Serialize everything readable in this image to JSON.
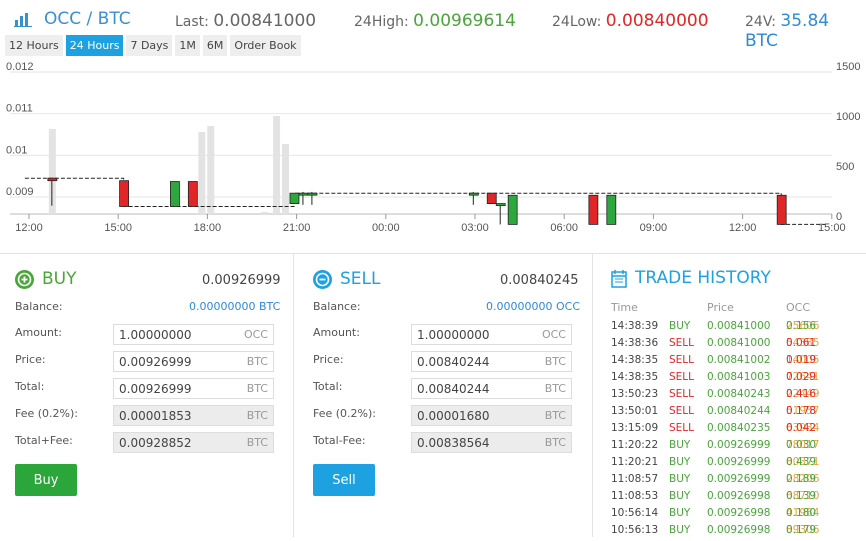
{
  "header": {
    "pair_base": "OCC",
    "pair_sep": " / ",
    "pair_quote": "BTC",
    "last_label": "Last:",
    "last_value": "0.00841000",
    "high_label": "24High:",
    "high_value": "0.00969614",
    "low_label": "24Low:",
    "low_value": "0.00840000",
    "vol_label": "24V:",
    "vol_value": "35.84 BTC"
  },
  "ranges": [
    "12 Hours",
    "24 Hours",
    "7 Days",
    "1M",
    "6M",
    "Order Book"
  ],
  "active_range": "24 Hours",
  "chart_data": {
    "type": "candlestick",
    "y_left_ticks": [
      "0.012",
      "0.011",
      "0.01",
      "0.009"
    ],
    "y_right_ticks": [
      "1500",
      "1000",
      "500",
      "0"
    ],
    "x_ticks": [
      "12:00",
      "15:00",
      "18:00",
      "21:00",
      "00:00",
      "03:00",
      "06:00",
      "09:00",
      "12:00",
      "15:00"
    ],
    "price_range": [
      0.0086,
      0.012
    ],
    "volume_range": [
      0,
      1500
    ],
    "time_range_hours": [
      11.5,
      15
    ],
    "candles": [
      {
        "t": 12.9,
        "o": 0.00926,
        "c": 0.0092,
        "h": 0.00926,
        "l": 0.0086
      },
      {
        "t": 15.3,
        "o": 0.0092,
        "c": 0.00858,
        "h": 0.0092,
        "l": 0.00858
      },
      {
        "t": 17.0,
        "o": 0.00858,
        "c": 0.00918,
        "h": 0.00918,
        "l": 0.00858
      },
      {
        "t": 17.6,
        "o": 0.00918,
        "c": 0.00858,
        "h": 0.00918,
        "l": 0.00858
      },
      {
        "t": 21.0,
        "o": 0.00865,
        "c": 0.0089,
        "h": 0.0089,
        "l": 0.00865
      },
      {
        "t": 21.3,
        "o": 0.0089,
        "c": 0.0089,
        "h": 0.00893,
        "l": 0.00862
      },
      {
        "t": 21.6,
        "o": 0.0089,
        "c": 0.0089,
        "h": 0.00893,
        "l": 0.00862
      },
      {
        "t": 27.0,
        "o": 0.0089,
        "c": 0.0089,
        "h": 0.00893,
        "l": 0.00862
      },
      {
        "t": 27.6,
        "o": 0.0089,
        "c": 0.00865,
        "h": 0.0089,
        "l": 0.00865
      },
      {
        "t": 27.9,
        "o": 0.00865,
        "c": 0.00865,
        "h": 0.00865,
        "l": 0.00815
      },
      {
        "t": 28.3,
        "o": 0.00815,
        "c": 0.00885,
        "h": 0.00885,
        "l": 0.00815
      },
      {
        "t": 31.0,
        "o": 0.00885,
        "c": 0.00815,
        "h": 0.00885,
        "l": 0.00815
      },
      {
        "t": 31.6,
        "o": 0.00815,
        "c": 0.00885,
        "h": 0.00885,
        "l": 0.00815
      },
      {
        "t": 37.3,
        "o": 0.00885,
        "c": 0.00815,
        "h": 0.00885,
        "l": 0.00815
      }
    ],
    "volumes": [
      {
        "t": 12.9,
        "v": 850
      },
      {
        "t": 17.9,
        "v": 820
      },
      {
        "t": 18.2,
        "v": 880
      },
      {
        "t": 20.4,
        "v": 980
      },
      {
        "t": 20.7,
        "v": 700
      },
      {
        "t": 20.0,
        "v": 20
      }
    ]
  },
  "buy": {
    "title": "BUY",
    "price": "0.00926999",
    "balance_label": "Balance:",
    "balance_value": "0.00000000 BTC",
    "amount_label": "Amount:",
    "amount_value": "1.00000000",
    "amount_unit": "OCC",
    "price_label": "Price:",
    "price_value": "0.00926999",
    "price_unit": "BTC",
    "total_label": "Total:",
    "total_value": "0.00926999",
    "total_unit": "BTC",
    "fee_label": "Fee (0.2%):",
    "fee_value": "0.00001853",
    "fee_unit": "BTC",
    "tf_label": "Total+Fee:",
    "tf_value": "0.00928852",
    "tf_unit": "BTC",
    "button": "Buy"
  },
  "sell": {
    "title": "SELL",
    "price": "0.00840245",
    "balance_label": "Balance:",
    "balance_value": "0.00000000 OCC",
    "amount_label": "Amount:",
    "amount_value": "1.00000000",
    "amount_unit": "OCC",
    "price_label": "Price:",
    "price_value": "0.00840244",
    "price_unit": "BTC",
    "total_label": "Total:",
    "total_value": "0.00840244",
    "total_unit": "BTC",
    "fee_label": "Fee (0.2%):",
    "fee_value": "0.00001680",
    "fee_unit": "BTC",
    "tf_label": "Total-Fee:",
    "tf_value": "0.00838564",
    "tf_unit": "BTC",
    "button": "Sell"
  },
  "history": {
    "title": "TRADE HISTORY",
    "col_time": "Time",
    "col_price": "Price",
    "col_amount": "OCC",
    "rows": [
      {
        "time": "14:38:39",
        "side": "BUY",
        "price": "0.00841000",
        "amt_a": "0.156",
        "amt_b": "25606"
      },
      {
        "time": "14:38:36",
        "side": "SELL",
        "price": "0.00841000",
        "amt_a": "0.061",
        "amt_b": "54385"
      },
      {
        "time": "14:38:35",
        "side": "SELL",
        "price": "0.00841002",
        "amt_a": "0.019",
        "amt_b": "14005"
      },
      {
        "time": "14:38:35",
        "side": "SELL",
        "price": "0.00841003",
        "amt_a": "0.029",
        "amt_b": "72641"
      },
      {
        "time": "13:50:23",
        "side": "SELL",
        "price": "0.00840243",
        "amt_a": "0.416",
        "amt_b": "22449"
      },
      {
        "time": "13:50:01",
        "side": "SELL",
        "price": "0.00840244",
        "amt_a": "0.178",
        "amt_b": "51957"
      },
      {
        "time": "13:15:09",
        "side": "SELL",
        "price": "0.00840235",
        "amt_a": "0.042",
        "amt_b": "63934"
      },
      {
        "time": "11:20:22",
        "side": "BUY",
        "price": "0.00926999",
        "amt_a": "0.030",
        "amt_b": "78017"
      },
      {
        "time": "11:20:21",
        "side": "BUY",
        "price": "0.00926999",
        "amt_a": "0.439",
        "amt_b": "80371"
      },
      {
        "time": "11:08:57",
        "side": "BUY",
        "price": "0.00926999",
        "amt_a": "0.189",
        "amt_b": "28206"
      },
      {
        "time": "11:08:53",
        "side": "BUY",
        "price": "0.00926998",
        "amt_a": "0.139",
        "amt_b": "68710"
      },
      {
        "time": "10:56:14",
        "side": "BUY",
        "price": "0.00926998",
        "amt_a": "0.180",
        "amt_b": "41984"
      },
      {
        "time": "10:56:13",
        "side": "BUY",
        "price": "0.00926998",
        "amt_a": "0.179",
        "amt_b": "89306"
      }
    ]
  },
  "colors": {
    "accent": "#1da1e0",
    "buy": "#4aa53b",
    "sell": "#e02626",
    "link": "#2c8bd6",
    "buy_button": "#2aa63a",
    "sell_button": "#1da1e0"
  }
}
